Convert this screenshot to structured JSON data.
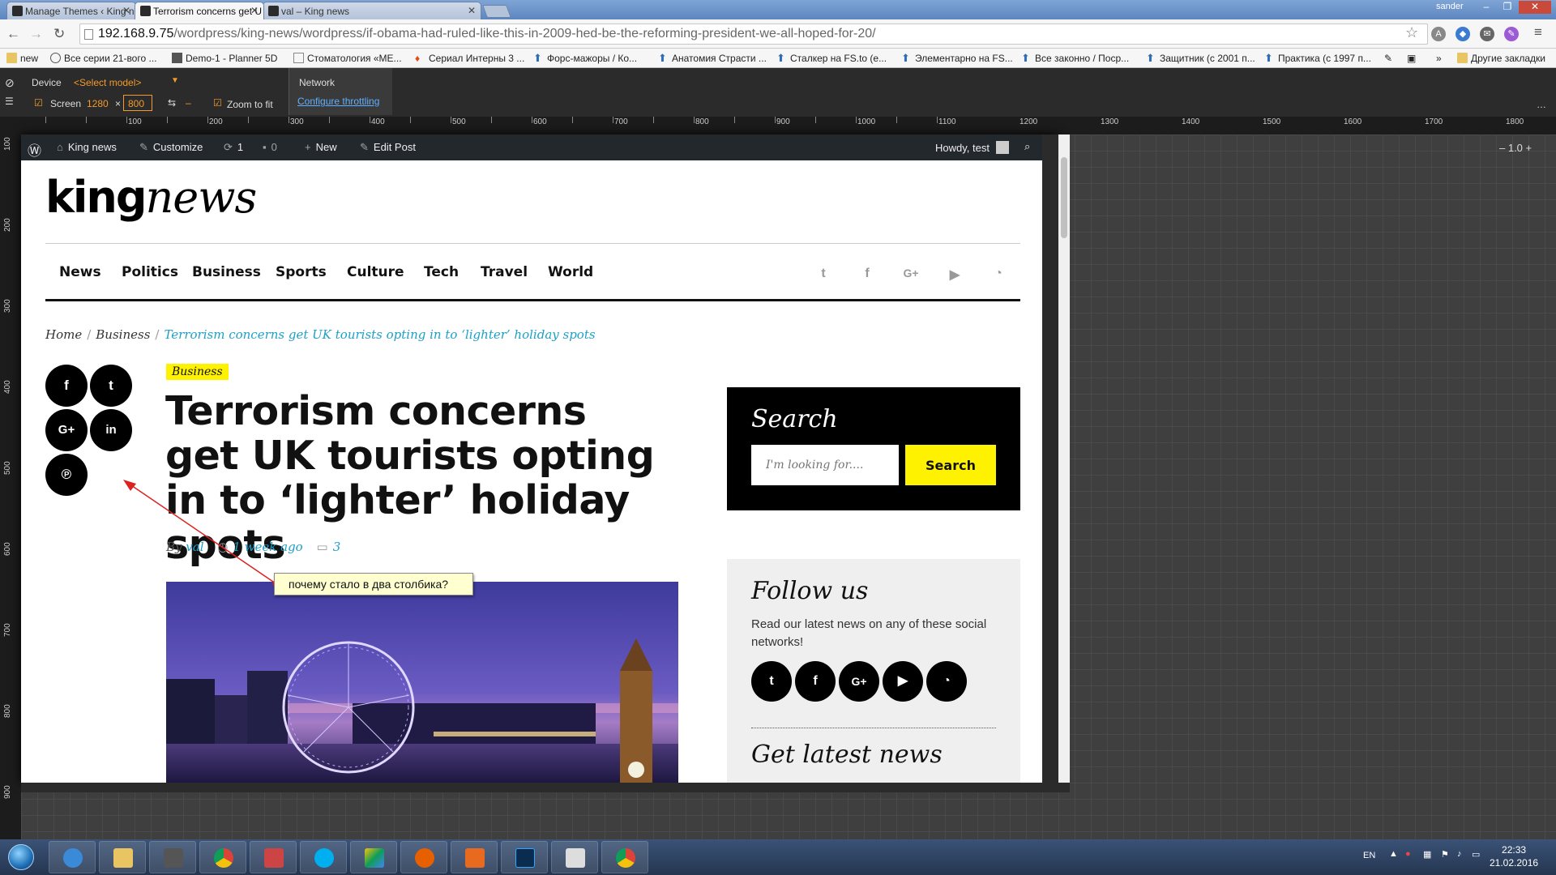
{
  "browser": {
    "tabs": [
      {
        "title": "Manage Themes ‹ King ne"
      },
      {
        "title": "Terrorism concerns get U"
      },
      {
        "title": "val – King news"
      }
    ],
    "user": "sander",
    "url_host": "192.168.9.75",
    "url_path": "/wordpress/king-news/wordpress/if-obama-had-ruled-like-this-in-2009-hed-be-the-reforming-president-we-all-hoped-for-20/",
    "bookmarks": [
      {
        "label": "new",
        "icon": "folder-icon"
      },
      {
        "label": "Все серии 21-вого ...",
        "icon": "globe-icon"
      },
      {
        "label": "Demo-1 - Planner 5D",
        "icon": "planner-icon"
      },
      {
        "label": "Стоматология «МЕ...",
        "icon": "page-icon"
      },
      {
        "label": "Сериал Интерны 3 ...",
        "icon": "flame-icon"
      },
      {
        "label": "Форс-мажоры / Ко...",
        "icon": "arrow-up-icon"
      },
      {
        "label": "Анатомия Страсти ...",
        "icon": "arrow-up-icon"
      },
      {
        "label": "Сталкер на FS.to (е...",
        "icon": "arrow-up-icon"
      },
      {
        "label": "Элементарно на FS...",
        "icon": "arrow-up-icon"
      },
      {
        "label": "Все законно / Поср...",
        "icon": "arrow-up-icon"
      },
      {
        "label": "Защитник (с 2001 п...",
        "icon": "arrow-up-icon"
      },
      {
        "label": "Практика (с 1997 п...",
        "icon": "arrow-up-icon"
      }
    ],
    "other_bookmarks": "Другие закладки",
    "more_bookmarks": "»"
  },
  "devtools": {
    "device_label": "Device",
    "model_select": "<Select model>",
    "screen_label": "Screen",
    "screen_width": "1280",
    "screen_x": "×",
    "screen_height": "800",
    "zoom_to_fit_label": "Zoom to fit",
    "network_label": "Network",
    "throttling_link": "Configure throttling",
    "zoom_value": "1.0",
    "ruler_top": [
      "100",
      "200",
      "300",
      "400",
      "500",
      "600",
      "700",
      "800",
      "900",
      "1000",
      "1100",
      "1200",
      "1300",
      "1400",
      "1500",
      "1600",
      "1700",
      "1800"
    ],
    "ruler_left": [
      "100",
      "200",
      "300",
      "400",
      "500",
      "600",
      "700",
      "800",
      "900"
    ]
  },
  "adminbar": {
    "site_name": "King news",
    "customize": "Customize",
    "updates_count": "1",
    "comments_count": "0",
    "new_label": "New",
    "edit_post": "Edit Post",
    "howdy": "Howdy, test"
  },
  "site": {
    "logo_bold": "king",
    "logo_italic": "news",
    "nav": [
      "News",
      "Politics",
      "Business",
      "Sports",
      "Culture",
      "Tech",
      "Travel",
      "World"
    ],
    "social_icons": [
      "twitter-icon",
      "facebook-icon",
      "google-plus-icon",
      "youtube-icon",
      "rss-icon"
    ]
  },
  "breadcrumb": {
    "home": "Home",
    "sep": "/",
    "section": "Business",
    "current": "Terrorism concerns get UK tourists opting in to ‘lighter’ holiday spots"
  },
  "post": {
    "category": "Business",
    "title": "Terrorism concerns get UK tourists opting in to ‘lighter’ holiday spots",
    "by": "By",
    "author": "val",
    "date": "1 week ago",
    "comments": "3"
  },
  "share_icons": [
    "facebook-icon",
    "twitter-icon",
    "google-plus-icon",
    "linkedin-icon",
    "pinterest-icon"
  ],
  "sidebar": {
    "search_title": "Search",
    "search_placeholder": "I'm looking for....",
    "search_button": "Search",
    "follow_title": "Follow us",
    "follow_text": "Read our latest news on any of these social networks!",
    "follow_icons": [
      "twitter-icon",
      "facebook-icon",
      "google-plus-icon",
      "youtube-icon",
      "rss-icon"
    ],
    "latest_title": "Get latest news"
  },
  "annotation": {
    "note": "почему стало в два столбика?"
  },
  "taskbar": {
    "apps": [
      "ie-icon",
      "explorer-icon",
      "sublime-icon",
      "chrome-icon",
      "xcv-icon",
      "skype-icon",
      "drive-icon",
      "firefox-icon",
      "outlook-icon",
      "photoshop-icon",
      "sketch-icon",
      "chrome-icon"
    ],
    "lang": "EN",
    "time": "22:33",
    "date": "21.02.2016"
  },
  "colors": {
    "accent_yellow": "#fff200",
    "link_blue": "#1da0c8",
    "admin_bar": "#23282d"
  }
}
